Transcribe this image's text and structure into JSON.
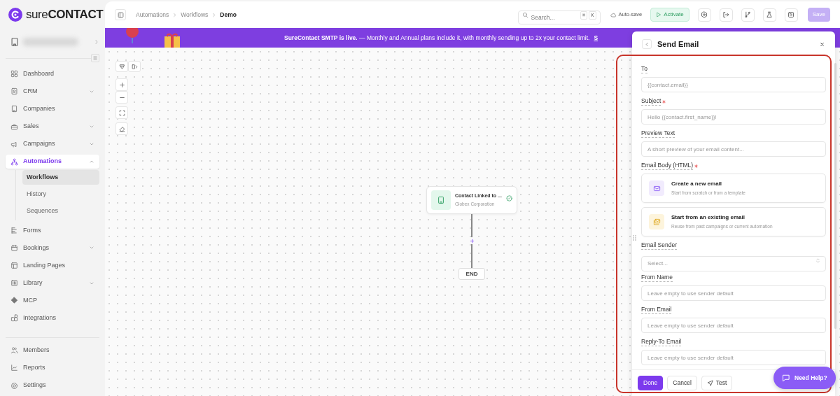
{
  "logo": "sure**CONTACT**",
  "nav_items": [
    {
      "label": "Dashboard",
      "selected": false
    },
    {
      "label": "CRM",
      "selected": false,
      "expanded": false
    },
    {
      "label": "Companies",
      "selected": false
    },
    {
      "label": "Sales",
      "selected": false,
      "expanded": false
    },
    {
      "label": "Campaigns",
      "selected": false,
      "expanded": false
    },
    {
      "label": "Automations",
      "selected": true,
      "expanded": true,
      "children": [
        {
          "label": "Workflows",
          "selected": true
        },
        {
          "label": "History",
          "selected": false
        },
        {
          "label": "Sequences",
          "selected": false
        }
      ]
    },
    {
      "label": "Forms",
      "selected": false
    },
    {
      "label": "Bookings",
      "selected": false,
      "expanded": false
    },
    {
      "label": "Landing Pages",
      "selected": false
    },
    {
      "label": "Library",
      "selected": false,
      "expanded": false
    },
    {
      "label": "MCP",
      "selected": false
    },
    {
      "label": "Integrations",
      "selected": false
    }
  ],
  "bottom_items": [
    {
      "label": "Members",
      "selected": false
    },
    {
      "label": "Reports",
      "selected": false
    },
    {
      "label": "Settings",
      "selected": false
    }
  ],
  "breadcrumb": [
    {
      "label": "Automations",
      "current": false
    },
    {
      "label": "Workflows",
      "current": false
    },
    {
      "label": "Demo",
      "current": true
    }
  ],
  "search": {
    "placeholder": "Search...",
    "shortcut": [
      "⌘",
      "K"
    ]
  },
  "autosave": "Auto-save",
  "activate": "Activate",
  "save": {
    "label": "Save",
    "disabled": true
  },
  "banner": {
    "text": "**SureContact SMTP is live.** — Monthly and Annual plans include it, with monthly sending up to 2x your contact limit.",
    "link": "S"
  },
  "workflow": {
    "node": {
      "title": "Contact Linked to ...",
      "subtitle": "Globex Corporation"
    },
    "end": "END"
  },
  "panel": {
    "title": "Send Email",
    "fields": [
      {
        "kind": "input",
        "label": "To",
        "required": false,
        "placeholder": "{{contact.email}}"
      },
      {
        "kind": "input",
        "label": "Subject",
        "required": true,
        "placeholder": "Hello {{contact.first_name}}!"
      },
      {
        "kind": "input",
        "label": "Preview Text",
        "required": false,
        "placeholder": "A short preview of your email content..."
      },
      {
        "kind": "choices",
        "label": "Email Body (HTML)",
        "required": true,
        "options": [
          {
            "title": "Create a new email",
            "description": "Start from scratch or from a template"
          },
          {
            "title": "Start from an existing email",
            "description": "Reuse from past campaigns or current automation"
          }
        ]
      },
      {
        "kind": "select",
        "label": "Email Sender",
        "required": false,
        "placeholder": "Select..."
      },
      {
        "kind": "input",
        "label": "From Name",
        "required": false,
        "placeholder": "Leave empty to use sender default"
      },
      {
        "kind": "input",
        "label": "From Email",
        "required": false,
        "placeholder": "Leave empty to use sender default"
      },
      {
        "kind": "input",
        "label": "Reply-To Email",
        "required": false,
        "placeholder": "Leave empty to use sender default"
      }
    ],
    "footer": [
      {
        "kind": "primary",
        "label": "Done"
      },
      {
        "kind": "secondary",
        "label": "Cancel"
      },
      {
        "kind": "test",
        "label": "Test"
      }
    ]
  },
  "help": "Need Help?"
}
